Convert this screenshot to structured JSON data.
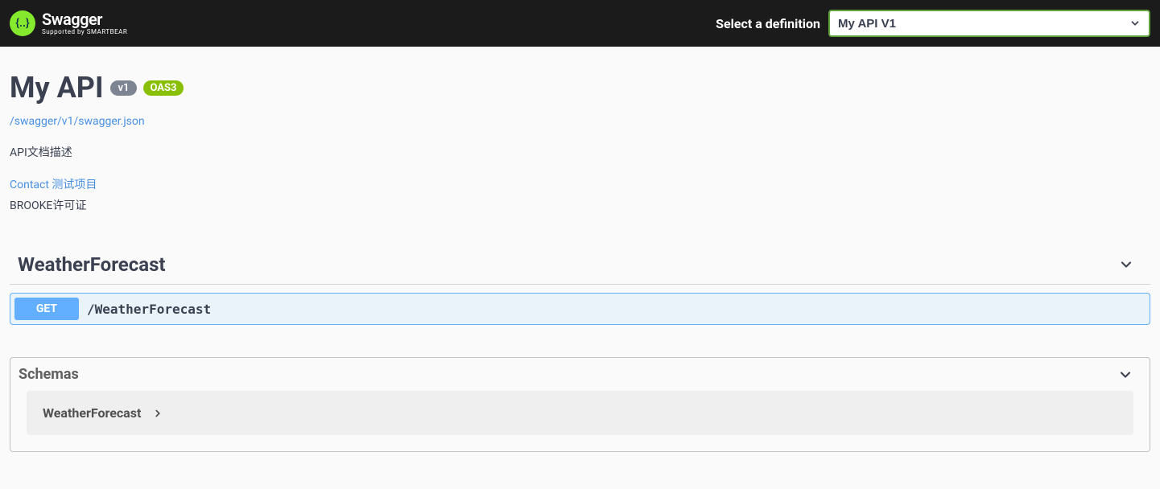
{
  "topbar": {
    "brand_title": "Swagger",
    "brand_subtitle": "Supported by SMARTBEAR",
    "select_label": "Select a definition",
    "selected_definition": "My API V1"
  },
  "info": {
    "title": "My API",
    "version": "v1",
    "oas_version": "OAS3",
    "spec_url": "/swagger/v1/swagger.json",
    "description": "API文档描述",
    "contact_label": "Contact 测试项目",
    "license_label": "BROOKE许可证"
  },
  "tags": [
    {
      "name": "WeatherForecast",
      "operations": [
        {
          "method": "GET",
          "path": "/WeatherForecast"
        }
      ]
    }
  ],
  "schemas": {
    "section_title": "Schemas",
    "items": [
      {
        "name": "WeatherForecast"
      }
    ]
  }
}
